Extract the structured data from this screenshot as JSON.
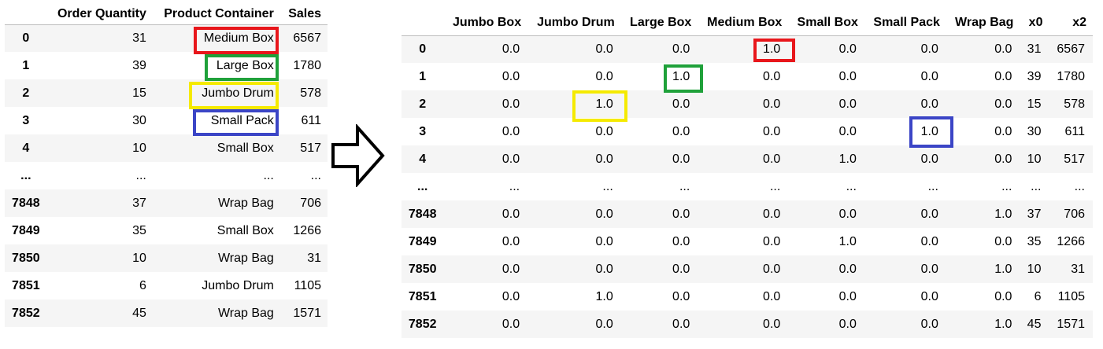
{
  "left_table": {
    "columns": [
      "",
      "Order Quantity",
      "Product Container",
      "Sales"
    ],
    "rows": [
      {
        "index": "0",
        "order_quantity": "31",
        "product_container": "Medium Box",
        "sales": "6567"
      },
      {
        "index": "1",
        "order_quantity": "39",
        "product_container": "Large Box",
        "sales": "1780"
      },
      {
        "index": "2",
        "order_quantity": "15",
        "product_container": "Jumbo Drum",
        "sales": "578"
      },
      {
        "index": "3",
        "order_quantity": "30",
        "product_container": "Small Pack",
        "sales": "611"
      },
      {
        "index": "4",
        "order_quantity": "10",
        "product_container": "Small Box",
        "sales": "517"
      },
      {
        "index": "...",
        "order_quantity": "...",
        "product_container": "...",
        "sales": "..."
      },
      {
        "index": "7848",
        "order_quantity": "37",
        "product_container": "Wrap Bag",
        "sales": "706"
      },
      {
        "index": "7849",
        "order_quantity": "35",
        "product_container": "Small Box",
        "sales": "1266"
      },
      {
        "index": "7850",
        "order_quantity": "10",
        "product_container": "Wrap Bag",
        "sales": "31"
      },
      {
        "index": "7851",
        "order_quantity": "6",
        "product_container": "Jumbo Drum",
        "sales": "1105"
      },
      {
        "index": "7852",
        "order_quantity": "45",
        "product_container": "Wrap Bag",
        "sales": "1571"
      }
    ]
  },
  "right_table": {
    "columns": [
      "",
      "Jumbo Box",
      "Jumbo Drum",
      "Large Box",
      "Medium Box",
      "Small Box",
      "Small Pack",
      "Wrap Bag",
      "x0",
      "x2"
    ],
    "rows": [
      [
        "0",
        "0.0",
        "0.0",
        "0.0",
        "1.0",
        "0.0",
        "0.0",
        "0.0",
        "31",
        "6567"
      ],
      [
        "1",
        "0.0",
        "0.0",
        "1.0",
        "0.0",
        "0.0",
        "0.0",
        "0.0",
        "39",
        "1780"
      ],
      [
        "2",
        "0.0",
        "1.0",
        "0.0",
        "0.0",
        "0.0",
        "0.0",
        "0.0",
        "15",
        "578"
      ],
      [
        "3",
        "0.0",
        "0.0",
        "0.0",
        "0.0",
        "0.0",
        "1.0",
        "0.0",
        "30",
        "611"
      ],
      [
        "4",
        "0.0",
        "0.0",
        "0.0",
        "0.0",
        "1.0",
        "0.0",
        "0.0",
        "10",
        "517"
      ],
      [
        "...",
        "...",
        "...",
        "...",
        "...",
        "...",
        "...",
        "...",
        "...",
        "..."
      ],
      [
        "7848",
        "0.0",
        "0.0",
        "0.0",
        "0.0",
        "0.0",
        "0.0",
        "1.0",
        "37",
        "706"
      ],
      [
        "7849",
        "0.0",
        "0.0",
        "0.0",
        "0.0",
        "1.0",
        "0.0",
        "0.0",
        "35",
        "1266"
      ],
      [
        "7850",
        "0.0",
        "0.0",
        "0.0",
        "0.0",
        "0.0",
        "0.0",
        "1.0",
        "10",
        "31"
      ],
      [
        "7851",
        "0.0",
        "1.0",
        "0.0",
        "0.0",
        "0.0",
        "0.0",
        "0.0",
        "6",
        "1105"
      ],
      [
        "7852",
        "0.0",
        "0.0",
        "0.0",
        "0.0",
        "0.0",
        "0.0",
        "1.0",
        "45",
        "1571"
      ]
    ]
  },
  "highlight_colors": {
    "medium_box": "#e8161b",
    "large_box": "#1fa13a",
    "jumbo_drum": "#f5ea00",
    "small_pack": "#3b45c6"
  },
  "arrow_icon": "right-arrow-outline-icon"
}
